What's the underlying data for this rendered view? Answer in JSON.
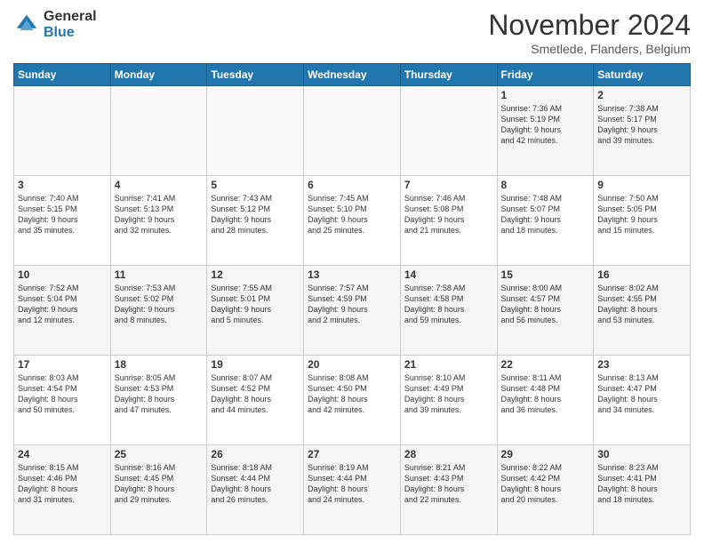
{
  "logo": {
    "general": "General",
    "blue": "Blue"
  },
  "header": {
    "month": "November 2024",
    "location": "Smetlede, Flanders, Belgium"
  },
  "days_header": [
    "Sunday",
    "Monday",
    "Tuesday",
    "Wednesday",
    "Thursday",
    "Friday",
    "Saturday"
  ],
  "weeks": [
    [
      {
        "day": "",
        "info": ""
      },
      {
        "day": "",
        "info": ""
      },
      {
        "day": "",
        "info": ""
      },
      {
        "day": "",
        "info": ""
      },
      {
        "day": "",
        "info": ""
      },
      {
        "day": "1",
        "info": "Sunrise: 7:36 AM\nSunset: 5:19 PM\nDaylight: 9 hours\nand 42 minutes."
      },
      {
        "day": "2",
        "info": "Sunrise: 7:38 AM\nSunset: 5:17 PM\nDaylight: 9 hours\nand 39 minutes."
      }
    ],
    [
      {
        "day": "3",
        "info": "Sunrise: 7:40 AM\nSunset: 5:15 PM\nDaylight: 9 hours\nand 35 minutes."
      },
      {
        "day": "4",
        "info": "Sunrise: 7:41 AM\nSunset: 5:13 PM\nDaylight: 9 hours\nand 32 minutes."
      },
      {
        "day": "5",
        "info": "Sunrise: 7:43 AM\nSunset: 5:12 PM\nDaylight: 9 hours\nand 28 minutes."
      },
      {
        "day": "6",
        "info": "Sunrise: 7:45 AM\nSunset: 5:10 PM\nDaylight: 9 hours\nand 25 minutes."
      },
      {
        "day": "7",
        "info": "Sunrise: 7:46 AM\nSunset: 5:08 PM\nDaylight: 9 hours\nand 21 minutes."
      },
      {
        "day": "8",
        "info": "Sunrise: 7:48 AM\nSunset: 5:07 PM\nDaylight: 9 hours\nand 18 minutes."
      },
      {
        "day": "9",
        "info": "Sunrise: 7:50 AM\nSunset: 5:05 PM\nDaylight: 9 hours\nand 15 minutes."
      }
    ],
    [
      {
        "day": "10",
        "info": "Sunrise: 7:52 AM\nSunset: 5:04 PM\nDaylight: 9 hours\nand 12 minutes."
      },
      {
        "day": "11",
        "info": "Sunrise: 7:53 AM\nSunset: 5:02 PM\nDaylight: 9 hours\nand 8 minutes."
      },
      {
        "day": "12",
        "info": "Sunrise: 7:55 AM\nSunset: 5:01 PM\nDaylight: 9 hours\nand 5 minutes."
      },
      {
        "day": "13",
        "info": "Sunrise: 7:57 AM\nSunset: 4:59 PM\nDaylight: 9 hours\nand 2 minutes."
      },
      {
        "day": "14",
        "info": "Sunrise: 7:58 AM\nSunset: 4:58 PM\nDaylight: 8 hours\nand 59 minutes."
      },
      {
        "day": "15",
        "info": "Sunrise: 8:00 AM\nSunset: 4:57 PM\nDaylight: 8 hours\nand 56 minutes."
      },
      {
        "day": "16",
        "info": "Sunrise: 8:02 AM\nSunset: 4:55 PM\nDaylight: 8 hours\nand 53 minutes."
      }
    ],
    [
      {
        "day": "17",
        "info": "Sunrise: 8:03 AM\nSunset: 4:54 PM\nDaylight: 8 hours\nand 50 minutes."
      },
      {
        "day": "18",
        "info": "Sunrise: 8:05 AM\nSunset: 4:53 PM\nDaylight: 8 hours\nand 47 minutes."
      },
      {
        "day": "19",
        "info": "Sunrise: 8:07 AM\nSunset: 4:52 PM\nDaylight: 8 hours\nand 44 minutes."
      },
      {
        "day": "20",
        "info": "Sunrise: 8:08 AM\nSunset: 4:50 PM\nDaylight: 8 hours\nand 42 minutes."
      },
      {
        "day": "21",
        "info": "Sunrise: 8:10 AM\nSunset: 4:49 PM\nDaylight: 8 hours\nand 39 minutes."
      },
      {
        "day": "22",
        "info": "Sunrise: 8:11 AM\nSunset: 4:48 PM\nDaylight: 8 hours\nand 36 minutes."
      },
      {
        "day": "23",
        "info": "Sunrise: 8:13 AM\nSunset: 4:47 PM\nDaylight: 8 hours\nand 34 minutes."
      }
    ],
    [
      {
        "day": "24",
        "info": "Sunrise: 8:15 AM\nSunset: 4:46 PM\nDaylight: 8 hours\nand 31 minutes."
      },
      {
        "day": "25",
        "info": "Sunrise: 8:16 AM\nSunset: 4:45 PM\nDaylight: 8 hours\nand 29 minutes."
      },
      {
        "day": "26",
        "info": "Sunrise: 8:18 AM\nSunset: 4:44 PM\nDaylight: 8 hours\nand 26 minutes."
      },
      {
        "day": "27",
        "info": "Sunrise: 8:19 AM\nSunset: 4:44 PM\nDaylight: 8 hours\nand 24 minutes."
      },
      {
        "day": "28",
        "info": "Sunrise: 8:21 AM\nSunset: 4:43 PM\nDaylight: 8 hours\nand 22 minutes."
      },
      {
        "day": "29",
        "info": "Sunrise: 8:22 AM\nSunset: 4:42 PM\nDaylight: 8 hours\nand 20 minutes."
      },
      {
        "day": "30",
        "info": "Sunrise: 8:23 AM\nSunset: 4:41 PM\nDaylight: 8 hours\nand 18 minutes."
      }
    ]
  ]
}
